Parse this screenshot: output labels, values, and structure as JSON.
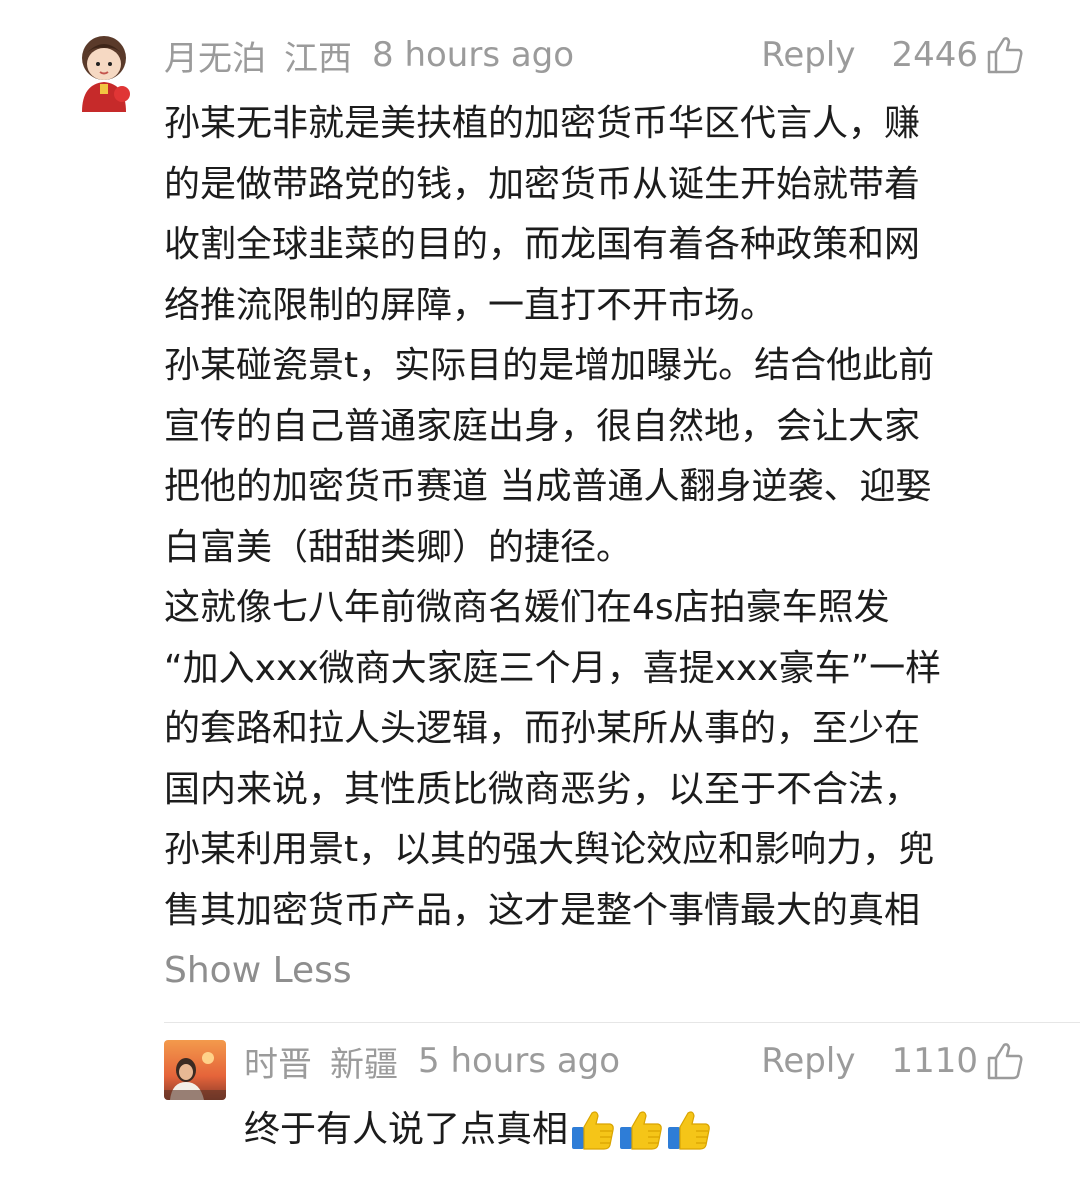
{
  "comments": [
    {
      "username": "月无泊",
      "location": "江西",
      "time": "8 hours ago",
      "reply_label": "Reply",
      "likes": "2446",
      "body_lines": [
        "孙某无非就是美扶植的加密货币华区代言人，赚",
        "的是做带路党的钱，加密货币从诞生开始就带着",
        "收割全球韭菜的目的，而龙国有着各种政策和网",
        "络推流限制的屏障，一直打不开市场。",
        "孙某碰瓷景t，实际目的是增加曝光。结合他此前",
        "宣传的自己普通家庭出身，很自然地，会让大家",
        "把他的加密货币赛道 当成普通人翻身逆袭、迎娶",
        "白富美（甜甜类卿）的捷径。",
        "这就像七八年前微商名媛们在4s店拍豪车照发",
        "“加入xxx微商大家庭三个月，喜提xxx豪车”一样",
        "的套路和拉人头逻辑，而孙某所从事的，至少在",
        "国内来说，其性质比微商恶劣，以至于不合法，",
        "孙某利用景t，以其的强大舆论效应和影响力，兜",
        "售其加密货币产品，这才是整个事情最大的真相"
      ],
      "show_less": "Show Less"
    },
    {
      "username": "时晋",
      "location": "新疆",
      "time": "5 hours ago",
      "reply_label": "Reply",
      "likes": "1110",
      "body": "终于有人说了点真相",
      "emojis": [
        "thumbs-up-emoji",
        "thumbs-up-emoji",
        "thumbs-up-emoji"
      ]
    }
  ],
  "colors": {
    "meta_gray": "#9b9b9b",
    "text": "#1c1c1c",
    "emoji_yellow": "#f5c518",
    "emoji_sleeve": "#2e7dd7"
  }
}
